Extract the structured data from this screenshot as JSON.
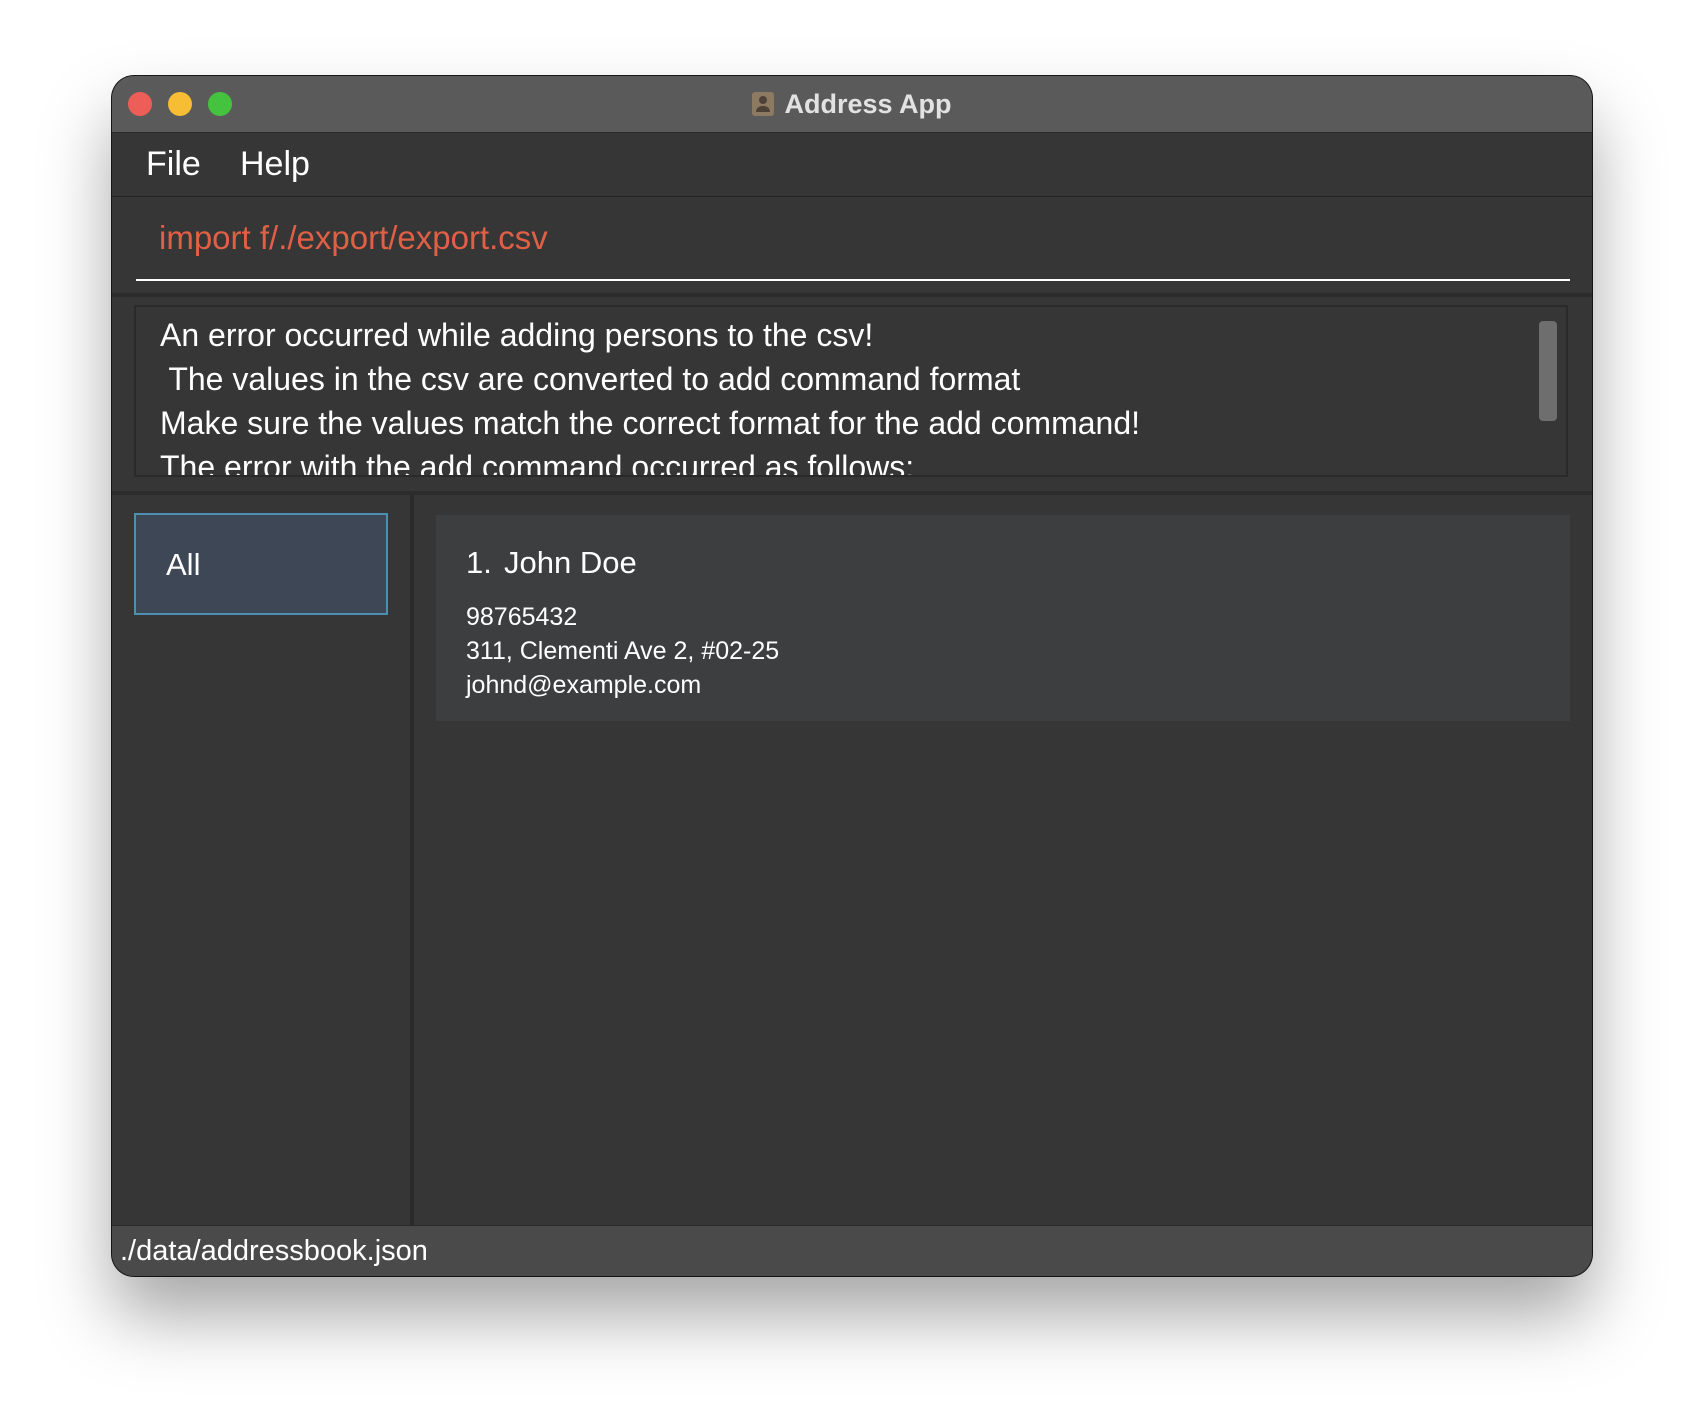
{
  "window": {
    "title": "Address App",
    "icon": "address-book-icon"
  },
  "menubar": {
    "items": [
      {
        "label": "File"
      },
      {
        "label": "Help"
      }
    ]
  },
  "command": {
    "value": "import f/./export/export.csv",
    "text_color": "#e06046"
  },
  "result": {
    "lines": [
      "An error occurred while adding persons to the csv!",
      " The values in the csv are converted to add command format",
      "Make sure the values match the correct format for the add command!",
      "The error with the add command occurred as follows:"
    ]
  },
  "sidebar": {
    "items": [
      {
        "label": "All",
        "selected": true
      }
    ],
    "selected_bg": "#3e4756",
    "selected_border": "#4c8fb0"
  },
  "person_list": [
    {
      "index": "1.",
      "name": "John Doe",
      "phone": "98765432",
      "address": "311, Clementi Ave 2, #02-25",
      "email": "johnd@example.com"
    }
  ],
  "status": {
    "file_path": "./data/addressbook.json"
  }
}
